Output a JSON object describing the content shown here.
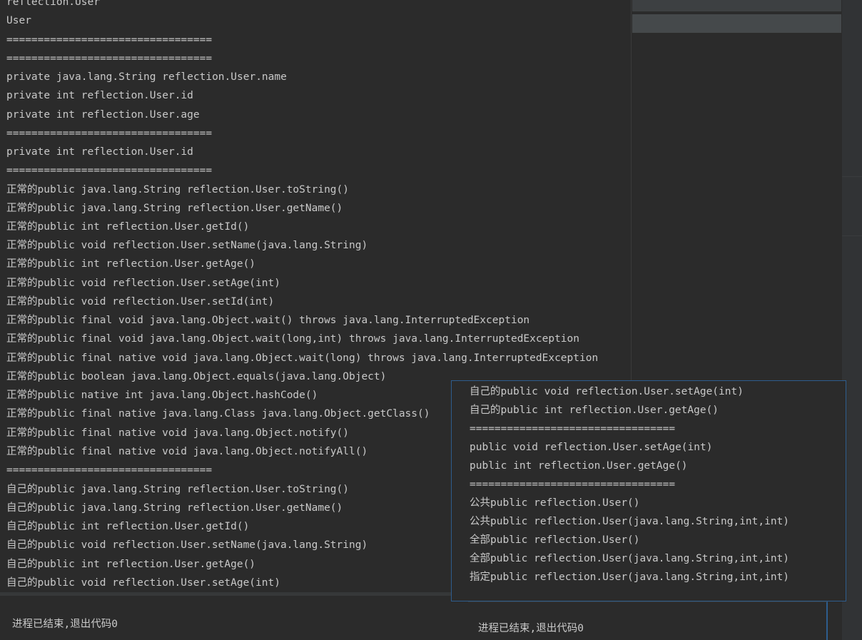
{
  "console_left": {
    "lines": [
      "reflection.User",
      "User",
      "=================================",
      "=================================",
      "private java.lang.String reflection.User.name",
      "private int reflection.User.id",
      "private int reflection.User.age",
      "=================================",
      "private int reflection.User.id",
      "=================================",
      "正常的public java.lang.String reflection.User.toString()",
      "正常的public java.lang.String reflection.User.getName()",
      "正常的public int reflection.User.getId()",
      "正常的public void reflection.User.setName(java.lang.String)",
      "正常的public int reflection.User.getAge()",
      "正常的public void reflection.User.setAge(int)",
      "正常的public void reflection.User.setId(int)",
      "正常的public final void java.lang.Object.wait() throws java.lang.InterruptedException",
      "正常的public final void java.lang.Object.wait(long,int) throws java.lang.InterruptedException",
      "正常的public final native void java.lang.Object.wait(long) throws java.lang.InterruptedException",
      "正常的public boolean java.lang.Object.equals(java.lang.Object)",
      "正常的public native int java.lang.Object.hashCode()",
      "正常的public final native java.lang.Class java.lang.Object.getClass()",
      "正常的public final native void java.lang.Object.notify()",
      "正常的public final native void java.lang.Object.notifyAll()",
      "=================================",
      "自己的public java.lang.String reflection.User.toString()",
      "自己的public java.lang.String reflection.User.getName()",
      "自己的public int reflection.User.getId()",
      "自己的public void reflection.User.setName(java.lang.String)",
      "自己的public int reflection.User.getAge()",
      "自己的public void reflection.User.setAge(int)"
    ],
    "exit_message": "进程已结束,退出代码0"
  },
  "popup": {
    "lines": [
      "自己的public void reflection.User.setAge(int)",
      "自己的public int reflection.User.getAge()",
      "=================================",
      "public void reflection.User.setAge(int)",
      "public int reflection.User.getAge()",
      "=================================",
      "公共public reflection.User()",
      "公共public reflection.User(java.lang.String,int,int)",
      "全部public reflection.User()",
      "全部public reflection.User(java.lang.String,int,int)",
      "指定public reflection.User(java.lang.String,int,int)"
    ],
    "exit_message": "进程已结束,退出代码0"
  },
  "colors": {
    "background": "#2b2b2b",
    "text": "#c9c9c9",
    "popup_border": "#2e5d8e"
  }
}
